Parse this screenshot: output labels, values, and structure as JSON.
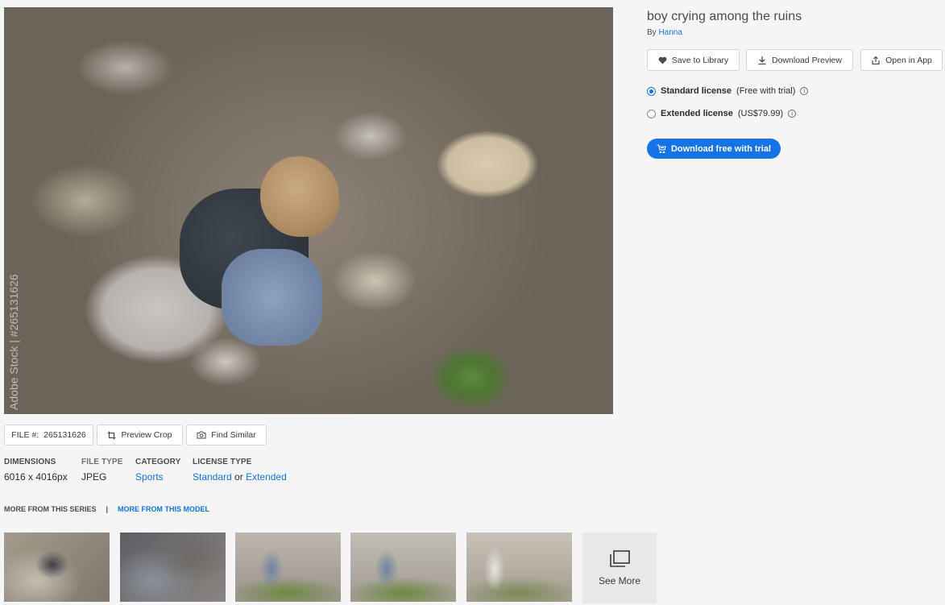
{
  "hero": {
    "watermark": "Adobe Stock | #265131626"
  },
  "asset": {
    "title": "boy crying among the ruins",
    "by_prefix": "By",
    "author": "Hanna"
  },
  "actions": {
    "save_library": "Save to Library",
    "download_preview": "Download Preview",
    "open_in_app": "Open in App"
  },
  "license": {
    "standard_label": "Standard license",
    "standard_note": "(Free with trial)",
    "extended_label": "Extended license",
    "extended_note": "(US$79.99)",
    "info_glyph": "i",
    "selected": "standard"
  },
  "primary_cta": "Download free with trial",
  "file": {
    "file_prefix": "FILE #:",
    "file_number": "265131626",
    "preview_crop": "Preview Crop",
    "find_similar": "Find Similar"
  },
  "meta": {
    "dimensions_label": "DIMENSIONS",
    "dimensions_value": "6016 x 4016px",
    "file_type_label": "FILE TYPE",
    "file_type_value": "JPEG",
    "category_label": "CATEGORY",
    "category_value": "Sports",
    "license_type_label": "LICENSE TYPE",
    "license_standard": "Standard",
    "license_or": "or",
    "license_extended": "Extended"
  },
  "series": {
    "series_tab": "MORE FROM THIS SERIES",
    "separator": "|",
    "model_tab": "MORE FROM THIS MODEL"
  },
  "see_more": "See More",
  "colors": {
    "accent": "#1473e6",
    "background": "#f5f5f5"
  }
}
